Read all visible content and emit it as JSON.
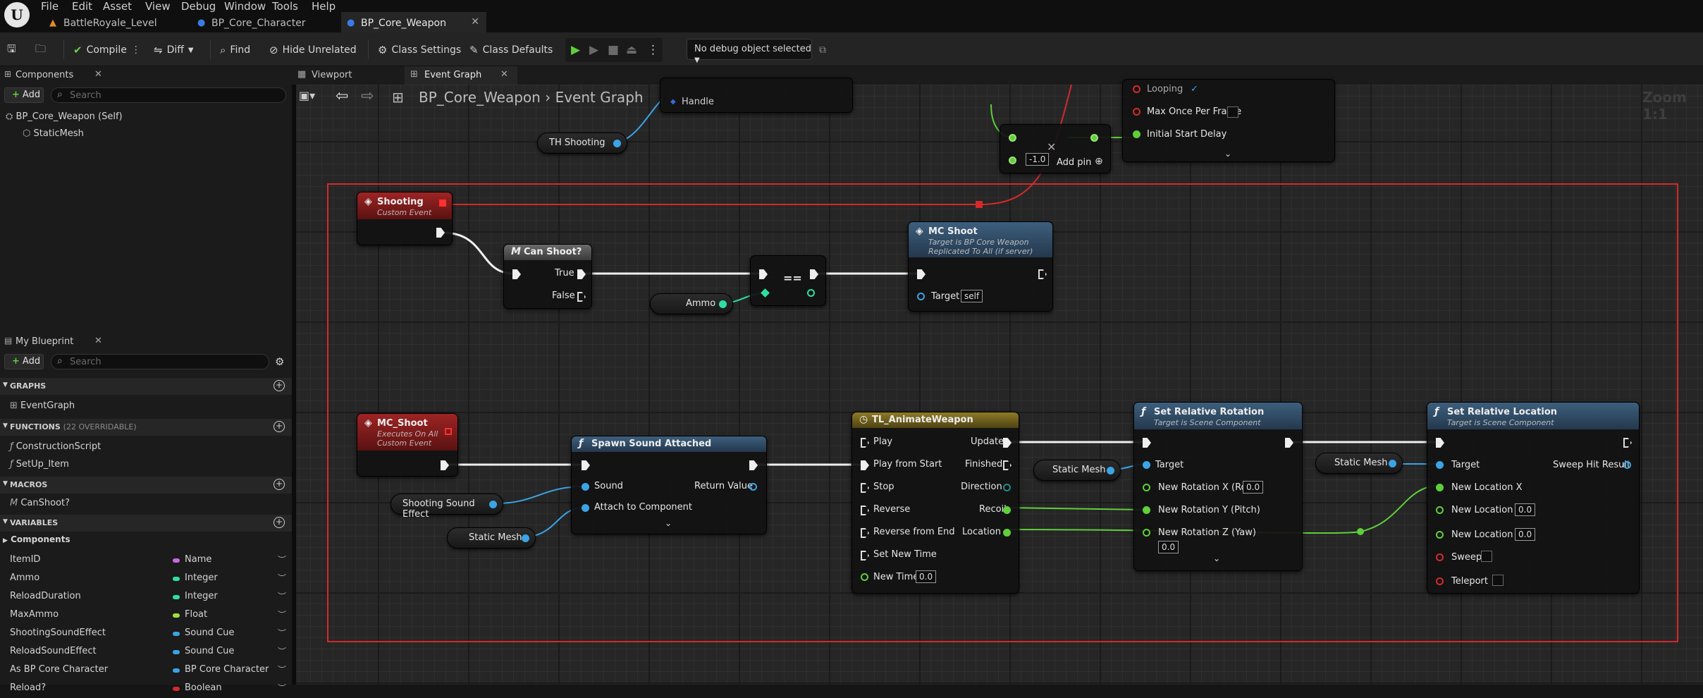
{
  "menu": [
    "File",
    "Edit",
    "Asset",
    "View",
    "Debug",
    "Window",
    "Tools",
    "Help"
  ],
  "tabs": [
    {
      "label": "BattleRoyale_Level"
    },
    {
      "label": "BP_Core_Character"
    },
    {
      "label": "BP_Core_Weapon"
    }
  ],
  "toolbar": {
    "compile": "Compile",
    "diff": "Diff",
    "find": "Find",
    "hide_unrelated": "Hide Unrelated",
    "class_settings": "Class Settings",
    "class_defaults": "Class Defaults",
    "debug_object": "No debug object selected"
  },
  "components": {
    "tab": "Components",
    "add": "Add",
    "search_placeholder": "Search",
    "items": [
      "BP_Core_Weapon (Self)",
      "StaticMesh"
    ]
  },
  "my_blueprint": {
    "tab": "My Blueprint",
    "add": "Add",
    "search_placeholder": "Search",
    "sections": {
      "graphs": "GRAPHS",
      "functions": "FUNCTIONS",
      "functions_note": "(22 OVERRIDABLE)",
      "macros": "MACROS",
      "variables": "VARIABLES"
    },
    "graphs": [
      "EventGraph"
    ],
    "functions": [
      "ConstructionScript",
      "SetUp_Item"
    ],
    "macros": [
      "CanShoot?"
    ],
    "components_cat": "Components",
    "variables": [
      {
        "name": "ItemID",
        "type": "Name",
        "color": "#c86ae0"
      },
      {
        "name": "Ammo",
        "type": "Integer",
        "color": "#2ee0a0"
      },
      {
        "name": "ReloadDuration",
        "type": "Integer",
        "color": "#2ee0a0"
      },
      {
        "name": "MaxAmmo",
        "type": "Float",
        "color": "#9ee03a"
      },
      {
        "name": "ShootingSoundEffect",
        "type": "Sound Cue",
        "color": "#3aa4e6"
      },
      {
        "name": "ReloadSoundEffect",
        "type": "Sound Cue",
        "color": "#3aa4e6"
      },
      {
        "name": "As BP Core Character",
        "type": "BP Core Character",
        "color": "#3aa4e6"
      },
      {
        "name": "Reload?",
        "type": "Boolean",
        "color": "#d42a2a"
      }
    ]
  },
  "graph": {
    "tab_viewport": "Viewport",
    "tab_event": "Event Graph",
    "breadcrumb_bp": "BP_Core_Weapon",
    "breadcrumb_graph": "Event Graph",
    "zoom": "Zoom 1:1"
  },
  "nodes": {
    "top_handle": "Handle",
    "th_shooting": "TH Shooting",
    "timer": {
      "looping": "Looping",
      "max_once": "Max Once Per Frame",
      "initial_delay": "Initial Start Delay"
    },
    "mult": {
      "val": "-1.0",
      "addpin": "Add pin"
    },
    "shooting": {
      "title": "Shooting",
      "sub": "Custom Event"
    },
    "canshoot": {
      "title": "Can Shoot?",
      "true": "True",
      "false": "False"
    },
    "ammo": "Ammo",
    "eq": "==",
    "mcshoot_call": {
      "title": "MC Shoot",
      "sub1": "Target is BP Core Weapon",
      "sub2": "Replicated To All (if server)",
      "target": "Target",
      "self": "self"
    },
    "mcshoot_ev": {
      "title": "MC_Shoot",
      "sub1": "Executes On All",
      "sub2": "Custom Event"
    },
    "spawn": {
      "title": "Spawn Sound Attached",
      "sound": "Sound",
      "attach": "Attach to Component",
      "ret": "Return Value"
    },
    "shooting_sfx": "Shooting Sound Effect",
    "static_mesh": "Static Mesh",
    "tl": {
      "title": "TL_AnimateWeapon",
      "play": "Play",
      "play_start": "Play from Start",
      "stop": "Stop",
      "reverse": "Reverse",
      "reverse_end": "Reverse from End",
      "set_new_time": "Set New Time",
      "new_time": "New Time",
      "new_time_val": "0.0",
      "update": "Update",
      "finished": "Finished",
      "direction": "Direction",
      "recoil": "Recoil",
      "location": "Location"
    },
    "setrot": {
      "title": "Set Relative Rotation",
      "sub": "Target is Scene Component",
      "target": "Target",
      "rx": "New Rotation X (Roll)",
      "ry": "New Rotation Y (Pitch)",
      "rz": "New Rotation Z (Yaw)",
      "rx_val": "0.0",
      "rz_val": "0.0"
    },
    "setloc": {
      "title": "Set Relative Location",
      "sub": "Target is Scene Component",
      "target": "Target",
      "sweep_hit": "Sweep Hit Result",
      "lx": "New Location X",
      "ly": "New Location Y",
      "lz": "New Location Z",
      "ly_val": "0.0",
      "lz_val": "0.0",
      "sweep": "Sweep",
      "teleport": "Teleport"
    }
  }
}
